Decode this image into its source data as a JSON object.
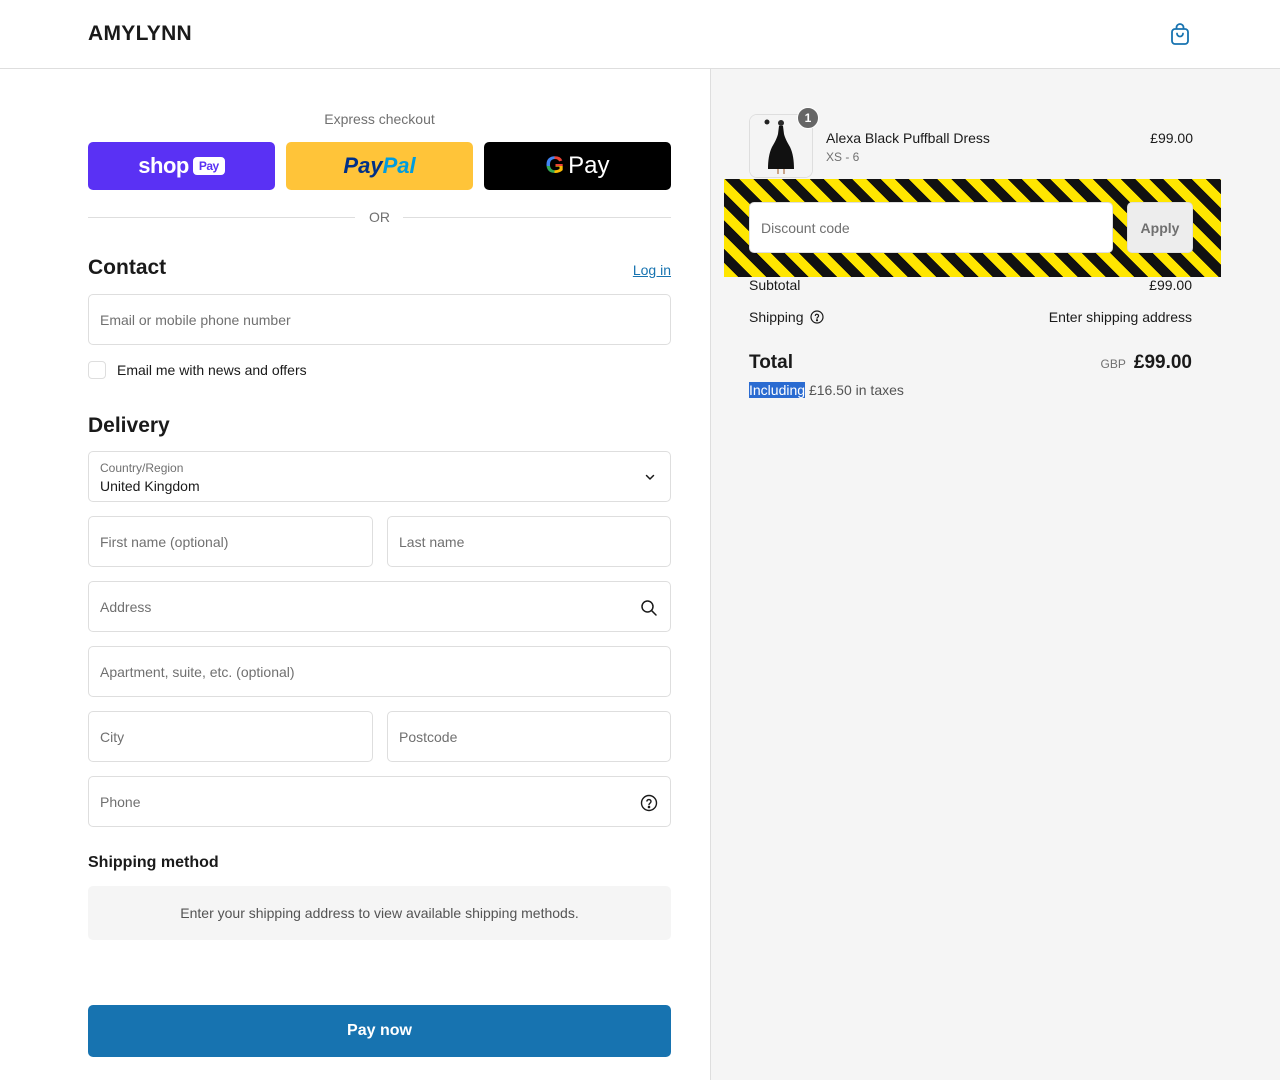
{
  "header": {
    "brand": "AMYLYNN",
    "cart_icon": "shopping-bag-icon"
  },
  "express": {
    "label": "Express checkout",
    "shop_pay_text": "shop",
    "shop_pay_badge": "Pay",
    "paypal_a": "Pay",
    "paypal_b": "Pal",
    "gpay_g": "G",
    "gpay_text": "Pay",
    "or": "OR"
  },
  "contact": {
    "title": "Contact",
    "login": "Log in",
    "email_placeholder": "Email or mobile phone number",
    "newsletter": "Email me with news and offers"
  },
  "delivery": {
    "title": "Delivery",
    "country_label": "Country/Region",
    "country_value": "United Kingdom",
    "first_name": "First name (optional)",
    "last_name": "Last name",
    "address": "Address",
    "apartment": "Apartment, suite, etc. (optional)",
    "city": "City",
    "postcode": "Postcode",
    "phone": "Phone"
  },
  "shipping_method": {
    "title": "Shipping method",
    "message": "Enter your shipping address to view available shipping methods."
  },
  "pay_now": "Pay now",
  "order": {
    "item": {
      "name": "Alexa Black Puffball Dress",
      "variant": "XS - 6",
      "price": "£99.00",
      "quantity": "1"
    },
    "discount_placeholder": "Discount code",
    "apply": "Apply",
    "subtotal_label": "Subtotal",
    "subtotal_value": "£99.00",
    "shipping_label": "Shipping",
    "shipping_value": "Enter shipping address",
    "total_label": "Total",
    "currency": "GBP",
    "total_value": "£99.00",
    "tax_highlight": "Including",
    "tax_rest": "£16.50 in taxes"
  },
  "colors": {
    "accent": "#1773b0",
    "shop_pay": "#5a31f4",
    "paypal": "#ffc439",
    "gpay": "#000000"
  }
}
